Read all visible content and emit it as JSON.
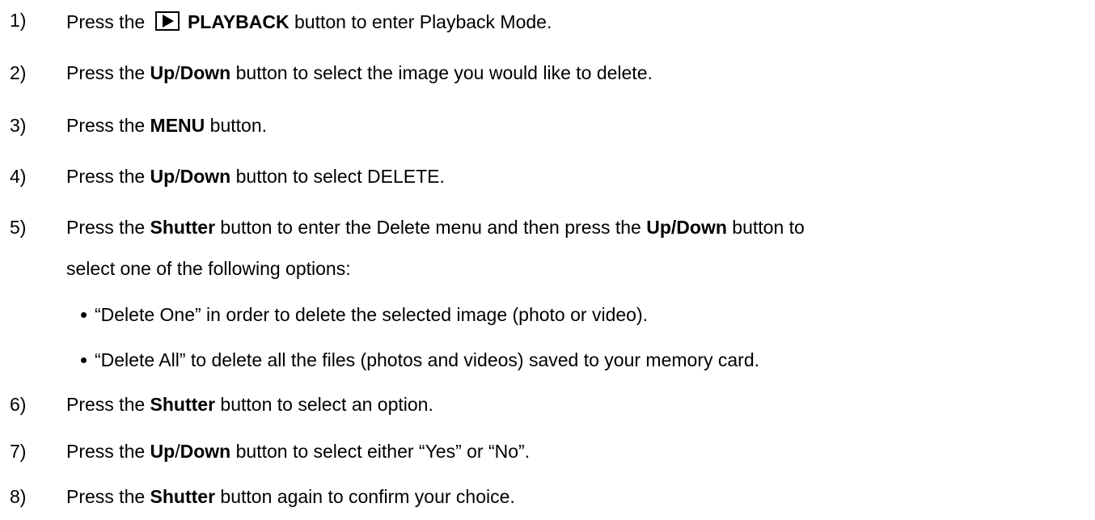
{
  "steps": [
    {
      "num": "1)",
      "a": "Press the ",
      "b": "PLAYBACK",
      "c": " button to enter Playback Mode."
    },
    {
      "num": "2)",
      "a": "Press the ",
      "b": "Up",
      "c": "/",
      "d": "Down",
      "e": " button to select the image you would like to delete."
    },
    {
      "num": "3)",
      "a": "Press the ",
      "b": "MENU",
      "c": " button."
    },
    {
      "num": "4)",
      "a": "Press the ",
      "b": "Up",
      "c": "/",
      "d": "Down",
      "e": " button to select DELETE."
    },
    {
      "num": "5)",
      "a": "Press the ",
      "b": "Shutter",
      "c": " button to enter the Delete menu and then press the ",
      "d": "Up/Down",
      "e": " button to",
      "cont": "select one of the following options:",
      "bullets": [
        "“Delete One” in order to delete the selected image (photo or video).",
        "“Delete All” to delete all the files (photos and videos) saved to your memory card."
      ]
    },
    {
      "num": "6)",
      "a": "Press the ",
      "b": "Shutter",
      "c": " button to select an option."
    },
    {
      "num": "7)",
      "a": "Press the ",
      "b": "Up",
      "c": "/",
      "d": "Down",
      "e": " button to select either “Yes” or “No”."
    },
    {
      "num": "8)",
      "a": "Press the ",
      "b": "Shutter",
      "c": " button again to confirm your choice."
    }
  ],
  "icons": {
    "playback": "play-icon"
  }
}
